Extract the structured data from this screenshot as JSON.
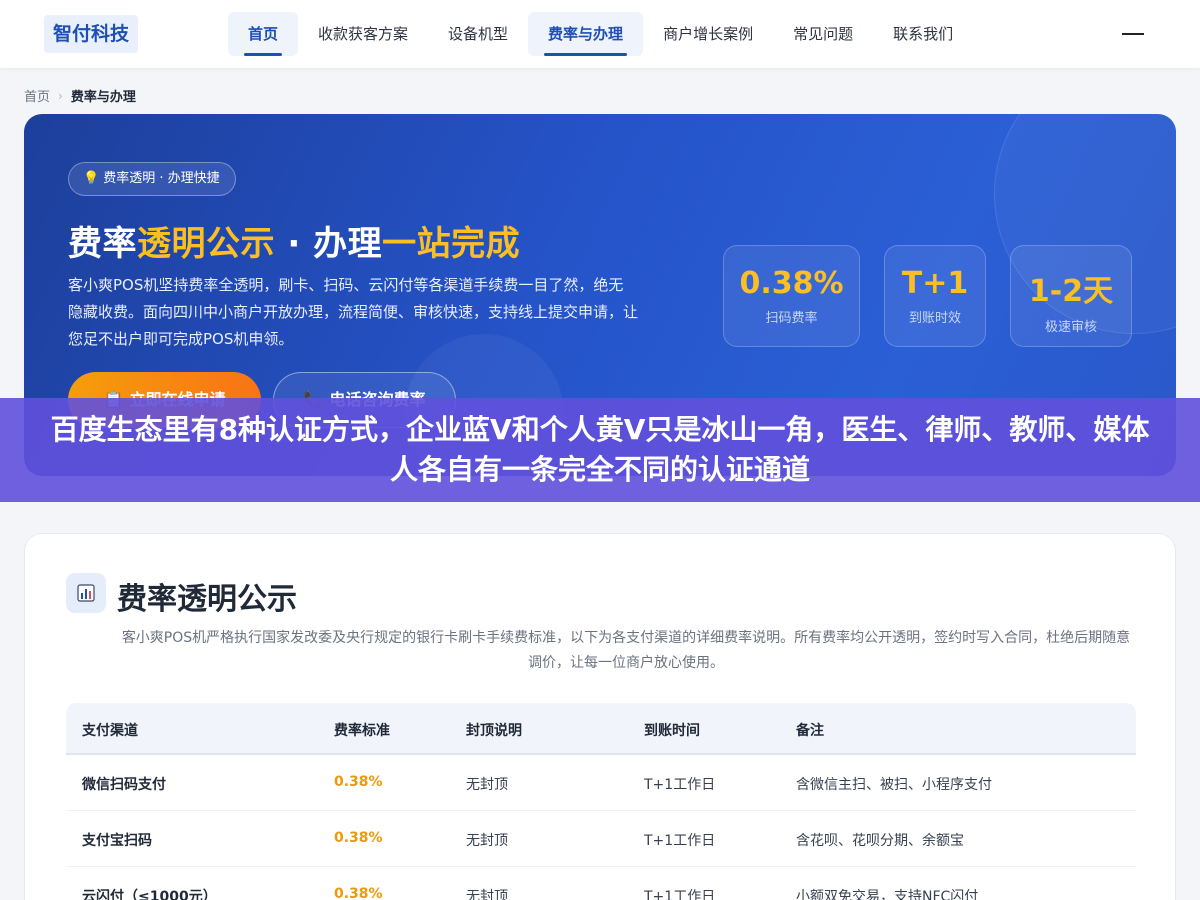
{
  "header": {
    "logo": "智付科技",
    "nav": [
      {
        "label": "首页",
        "active": true
      },
      {
        "label": "收款获客方案",
        "active": false
      },
      {
        "label": "设备机型",
        "active": false
      },
      {
        "label": "费率与办理",
        "active": true
      },
      {
        "label": "商户增长案例",
        "active": false
      },
      {
        "label": "常见问题",
        "active": false
      },
      {
        "label": "联系我们",
        "active": false
      }
    ]
  },
  "breadcrumb": {
    "home": "首页",
    "separator": "›",
    "current": "费率与办理"
  },
  "hero": {
    "pill": "费率透明 · 办理快捷",
    "title_part1": "费率",
    "title_part2": "透明公示",
    "title_part3": " · 办理",
    "title_part4": "一站完成",
    "description": "客小爽POS机坚持费率全透明，刷卡、扫码、云闪付等各渠道手续费一目了然，绝无隐藏收费。面向四川中小商户开放办理，流程简便、审核快速，支持线上提交申请，让您足不出户即可完成POS机申领。",
    "primary_button": "立即在线申请",
    "secondary_button": "电话咨询费率",
    "stats": [
      {
        "value": "0.38%",
        "label": "扫码费率"
      },
      {
        "value": "T+1",
        "label": "到账时效"
      },
      {
        "value": "1-2天",
        "label": "极速审核"
      }
    ],
    "colors": {
      "highlight": "#fbbf24",
      "primary_button": "#f59e0b"
    }
  },
  "overlay": {
    "text": "百度生态里有8种认证方式，企业蓝V和个人黄V只是冰山一角，医生、律师、教师、媒体人各自有一条完全不同的认证通道"
  },
  "section": {
    "title": "费率透明公示",
    "description": "客小爽POS机严格执行国家发改委及央行规定的银行卡刷卡手续费标准，以下为各支付渠道的详细费率说明。所有费率均公开透明，签约时写入合同，杜绝后期随意调价，让每一位商户放心使用。",
    "table": {
      "headers": [
        "支付渠道",
        "费率标准",
        "封顶说明",
        "到账时间",
        "备注"
      ],
      "rows": [
        [
          "微信扫码支付",
          "0.38%",
          "无封顶",
          "T+1工作日",
          "含微信主扫、被扫、小程序支付"
        ],
        [
          "支付宝扫码",
          "0.38%",
          "无封顶",
          "T+1工作日",
          "含花呗、花呗分期、余额宝"
        ],
        [
          "云闪付（≤1000元）",
          "0.38%",
          "无封顶",
          "T+1工作日",
          "小额双免交易，支持NFC闪付"
        ]
      ]
    }
  }
}
